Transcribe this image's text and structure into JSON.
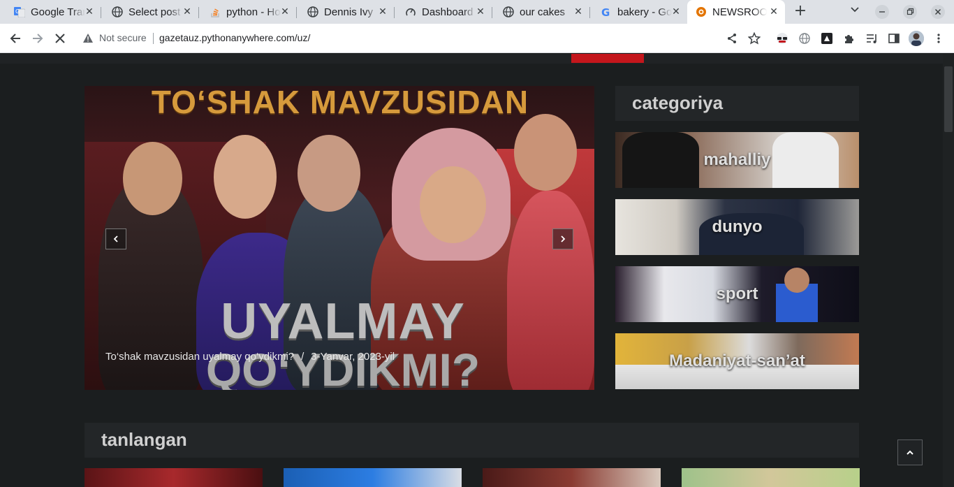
{
  "browser": {
    "tabs": [
      {
        "title": "Google Translate",
        "favicon": "google-translate-icon"
      },
      {
        "title": "Select post",
        "favicon": "globe-icon"
      },
      {
        "title": "python - How",
        "favicon": "stackoverflow-icon"
      },
      {
        "title": "Dennis Ivy",
        "favicon": "globe-icon"
      },
      {
        "title": "Dashboard",
        "favicon": "dashboard-icon"
      },
      {
        "title": "our cakes",
        "favicon": "globe-icon"
      },
      {
        "title": "bakery - Google",
        "favicon": "google-icon"
      },
      {
        "title": "NEWSROOM",
        "favicon": "newsroom-icon",
        "active": true
      }
    ],
    "security_label": "Not secure",
    "url": "gazetauz.pythonanywhere.com/uz/"
  },
  "hero": {
    "image_top_text": "TO‘SHAK MAVZUSIDAN",
    "image_bottom_line1": "UYALMAY",
    "image_bottom_line2": "QO‘YDIKMI?",
    "caption_title": "To‘shak mavzusidan uyalmay qo‘ydikmi?",
    "caption_sep": "/",
    "caption_date": "3-Yanvar, 2023-yil"
  },
  "categories": {
    "heading": "categoriya",
    "items": [
      {
        "label": "mahalliy"
      },
      {
        "label": "dunyo"
      },
      {
        "label": "sport"
      },
      {
        "label": "Madaniyat-san’at"
      }
    ]
  },
  "featured": {
    "heading": "tanlangan"
  },
  "colors": {
    "accent": "#c4161c",
    "page_bg": "#1b1e1f",
    "panel_bg": "#232628"
  }
}
